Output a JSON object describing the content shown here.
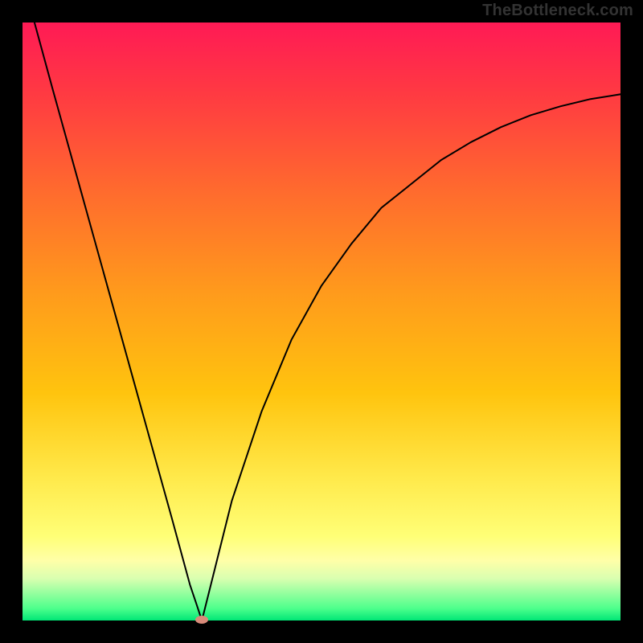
{
  "watermark": "TheBottleneck.com",
  "chart_data": {
    "type": "line",
    "title": "",
    "xlabel": "",
    "ylabel": "",
    "xlim": [
      0,
      100
    ],
    "ylim": [
      0,
      100
    ],
    "series": [
      {
        "name": "left-branch",
        "x": [
          2,
          5,
          10,
          15,
          20,
          25,
          28,
          29,
          30
        ],
        "values": [
          100,
          89,
          71,
          53,
          35,
          17,
          6,
          3,
          0
        ]
      },
      {
        "name": "right-branch",
        "x": [
          30,
          32,
          35,
          40,
          45,
          50,
          55,
          60,
          65,
          70,
          75,
          80,
          85,
          90,
          95,
          100
        ],
        "values": [
          0,
          8,
          20,
          35,
          47,
          56,
          63,
          69,
          73,
          77,
          80,
          82.5,
          84.5,
          86,
          87.2,
          88
        ]
      }
    ],
    "minimum_marker": {
      "x": 30,
      "y": 0
    },
    "background_gradient": {
      "stops": [
        {
          "pos": 0,
          "color": "#ff1a55"
        },
        {
          "pos": 12,
          "color": "#ff3a42"
        },
        {
          "pos": 28,
          "color": "#ff6a2e"
        },
        {
          "pos": 45,
          "color": "#ff9a1c"
        },
        {
          "pos": 62,
          "color": "#ffc40e"
        },
        {
          "pos": 76,
          "color": "#ffe94a"
        },
        {
          "pos": 86,
          "color": "#ffff77"
        },
        {
          "pos": 90,
          "color": "#ffffa8"
        },
        {
          "pos": 93,
          "color": "#d9ffb0"
        },
        {
          "pos": 98,
          "color": "#4dff8c"
        },
        {
          "pos": 100,
          "color": "#00e676"
        }
      ]
    }
  }
}
